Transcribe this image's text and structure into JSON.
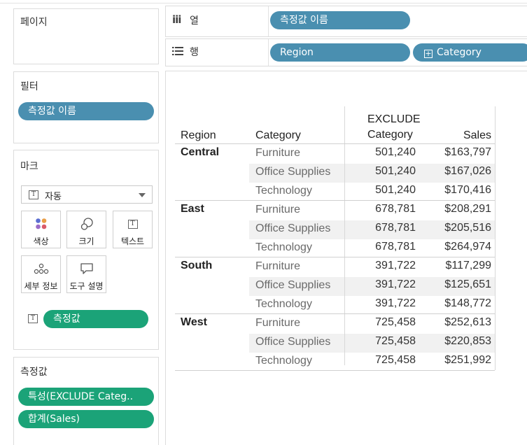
{
  "pages_card": {
    "title": "페이지"
  },
  "filters_card": {
    "title": "필터",
    "pills": [
      "측정값 이름"
    ]
  },
  "marks_card": {
    "title": "마크",
    "type_select": {
      "value": "자동"
    },
    "buttons": [
      {
        "label": "색상",
        "icon": "color-icon"
      },
      {
        "label": "크기",
        "icon": "size-icon"
      },
      {
        "label": "텍스트",
        "icon": "text-icon"
      },
      {
        "label": "세부 정보",
        "icon": "detail-icon"
      },
      {
        "label": "도구 설명",
        "icon": "tooltip-icon"
      }
    ],
    "text_pill": "측정값"
  },
  "measures_card": {
    "title": "측정값",
    "pills": [
      "특성(EXCLUDE Categ..",
      "합계(Sales)"
    ]
  },
  "shelves": {
    "columns": {
      "label": "열",
      "pills": [
        "측정값 이름"
      ]
    },
    "rows": {
      "label": "행",
      "pills": [
        "Region",
        "Category"
      ]
    }
  },
  "table": {
    "headers": {
      "region": "Region",
      "category": "Category",
      "exclude_line1": "EXCLUDE",
      "exclude_line2": "Category",
      "sales": "Sales"
    },
    "groups": [
      {
        "region": "Central",
        "rows": [
          {
            "category": "Furniture",
            "exclude": "501,240",
            "sales": "$163,797"
          },
          {
            "category": "Office Supplies",
            "exclude": "501,240",
            "sales": "$167,026"
          },
          {
            "category": "Technology",
            "exclude": "501,240",
            "sales": "$170,416"
          }
        ]
      },
      {
        "region": "East",
        "rows": [
          {
            "category": "Furniture",
            "exclude": "678,781",
            "sales": "$208,291"
          },
          {
            "category": "Office Supplies",
            "exclude": "678,781",
            "sales": "$205,516"
          },
          {
            "category": "Technology",
            "exclude": "678,781",
            "sales": "$264,974"
          }
        ]
      },
      {
        "region": "South",
        "rows": [
          {
            "category": "Furniture",
            "exclude": "391,722",
            "sales": "$117,299"
          },
          {
            "category": "Office Supplies",
            "exclude": "391,722",
            "sales": "$125,651"
          },
          {
            "category": "Technology",
            "exclude": "391,722",
            "sales": "$148,772"
          }
        ]
      },
      {
        "region": "West",
        "rows": [
          {
            "category": "Furniture",
            "exclude": "725,458",
            "sales": "$252,613"
          },
          {
            "category": "Office Supplies",
            "exclude": "725,458",
            "sales": "$220,853"
          },
          {
            "category": "Technology",
            "exclude": "725,458",
            "sales": "$251,992"
          }
        ]
      }
    ]
  },
  "colors": {
    "dimension_pill": "#4a8fb0",
    "measure_pill": "#1ba378"
  }
}
